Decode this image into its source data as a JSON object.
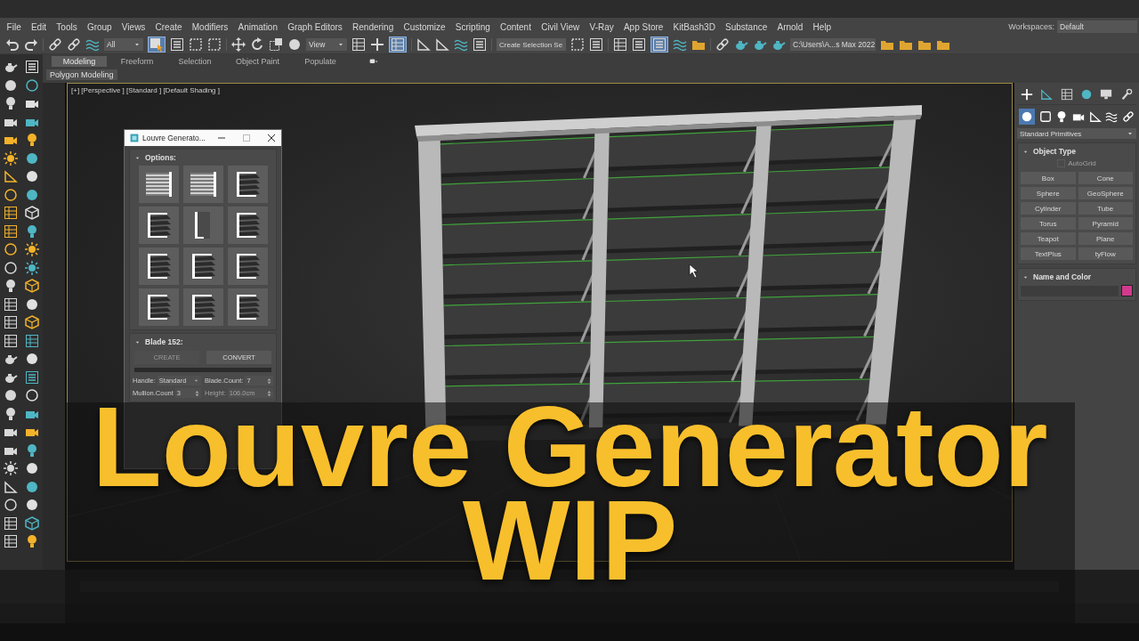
{
  "menu_bar": {
    "items": [
      "File",
      "Edit",
      "Tools",
      "Group",
      "Views",
      "Create",
      "Modifiers",
      "Animation",
      "Graph Editors",
      "Rendering",
      "Customize",
      "Scripting",
      "Content",
      "Civil View",
      "V-Ray",
      "App Store",
      "KitBash3D",
      "Substance",
      "Arnold",
      "Help"
    ],
    "workspaces_label": "Workspaces:",
    "workspace": "Default"
  },
  "main_toolbar": {
    "selection_filter": "All",
    "reference_coordinate": "View",
    "named_selection": "Create Selection Se",
    "project_folder": "C:\\Users\\A...s Max 2022"
  },
  "ribbon": {
    "tabs": [
      {
        "label": "Modeling",
        "selected": true
      },
      {
        "label": "Freeform",
        "selected": false
      },
      {
        "label": "Selection",
        "selected": false
      },
      {
        "label": "Object Paint",
        "selected": false
      },
      {
        "label": "Populate",
        "selected": false
      }
    ],
    "panel_label": "Polygon Modeling"
  },
  "viewport": {
    "label": "[+] [Perspective ] [Standard ] [Default Shading ]"
  },
  "dialog": {
    "title": "Louvre Generato...",
    "options": {
      "title": "Options:",
      "presets": [
        {
          "kind": "flat"
        },
        {
          "kind": "flat"
        },
        {
          "kind": "blade"
        },
        {
          "kind": "blade"
        },
        {
          "kind": "door"
        },
        {
          "kind": "blade"
        },
        {
          "kind": "blade"
        },
        {
          "kind": "blade"
        },
        {
          "kind": "blade"
        },
        {
          "kind": "blade"
        },
        {
          "kind": "blade"
        },
        {
          "kind": "blade"
        }
      ]
    },
    "blade": {
      "title": "Blade 152:",
      "buttons": [
        {
          "label": "CREATE",
          "disabled": true
        },
        {
          "label": "CONVERT",
          "disabled": false
        }
      ],
      "progress": {
        "level": 0
      },
      "fields": [
        {
          "label": "Handle:",
          "value": "Standard",
          "kind": "dropdown",
          "disabled": false
        },
        {
          "label": "Blade.Count:",
          "value": "7",
          "kind": "spinner",
          "disabled": false
        },
        {
          "label": "Mullion.Count",
          "value": "3",
          "kind": "spinner",
          "disabled": false
        },
        {
          "label": "Height:",
          "value": "106.0cm",
          "kind": "spinner",
          "disabled": true
        }
      ]
    }
  },
  "command_panel": {
    "category": "Standard Primitives",
    "object_type": {
      "title": "Object Type",
      "autogrid": {
        "label": "AutoGrid",
        "checked": false,
        "disabled": true
      },
      "buttons": [
        "Box",
        "Cone",
        "Sphere",
        "GeoSphere",
        "Cylinder",
        "Tube",
        "Torus",
        "Pyramid",
        "Teapot",
        "Plane",
        "TextPlus",
        "tyFlow"
      ]
    },
    "name_and_color": {
      "title": "Name and Color",
      "color": "#d23a8e"
    }
  },
  "overlay_title": {
    "lines": [
      "Louvre Generator",
      "WIP"
    ]
  }
}
